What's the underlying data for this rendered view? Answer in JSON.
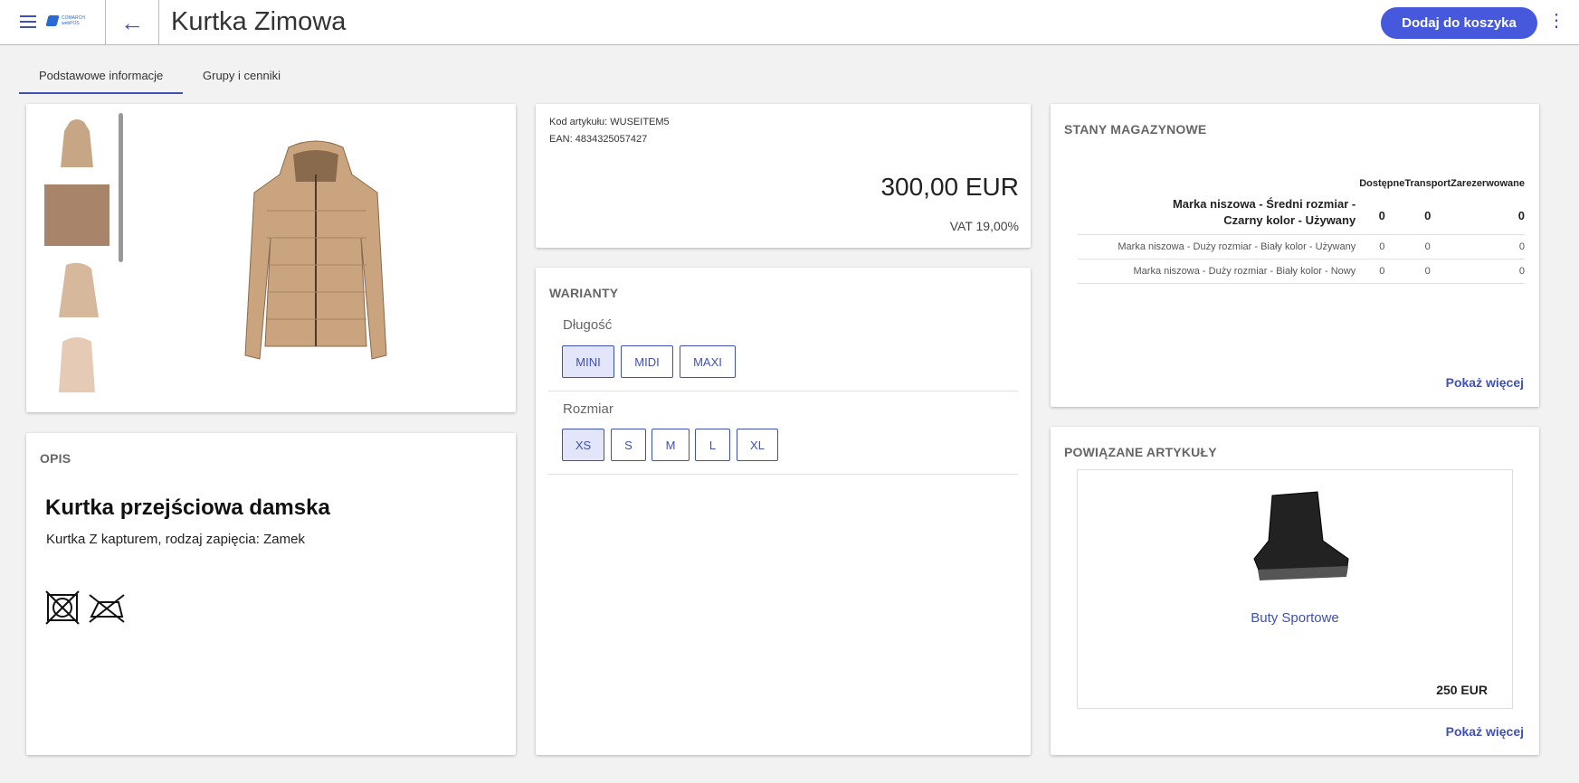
{
  "header": {
    "title": "Kurtka Zimowa",
    "add_to_cart": "Dodaj do koszyka",
    "logo_text": "COMARCH webPOS"
  },
  "tabs": [
    {
      "label": "Podstawowe informacje",
      "active": true
    },
    {
      "label": "Grupy i cenniki",
      "active": false
    }
  ],
  "article": {
    "code": "Kod artykułu: WUSEITEM5",
    "ean": "EAN: 4834325057427",
    "price": "300,00 EUR",
    "vat": "VAT 19,00%"
  },
  "description": {
    "title": "OPIS",
    "heading": "Kurtka przejściowa damska",
    "text": "Kurtka Z kapturem, rodzaj zapięcia: Zamek"
  },
  "variants": {
    "title": "WARIANTY",
    "groups": [
      {
        "label": "Długość",
        "options": [
          "MINI",
          "MIDI",
          "MAXI"
        ],
        "selected": "MINI"
      },
      {
        "label": "Rozmiar",
        "options": [
          "XS",
          "S",
          "M",
          "L",
          "XL"
        ],
        "selected": "XS"
      }
    ]
  },
  "stock": {
    "title": "STANY MAGAZYNOWE",
    "columns": [
      "Dostępne",
      "Transport",
      "Zarezerwowane"
    ],
    "rows": [
      {
        "name": "Marka niszowa - Średni rozmiar - Czarny kolor - Używany",
        "values": [
          "0",
          "0",
          "0"
        ]
      },
      {
        "name": "Marka niszowa - Duży rozmiar - Biały kolor - Używany",
        "values": [
          "0",
          "0",
          "0"
        ]
      },
      {
        "name": "Marka niszowa - Duży rozmiar - Biały kolor - Nowy",
        "values": [
          "0",
          "0",
          "0"
        ]
      }
    ],
    "more": "Pokaż więcej"
  },
  "related": {
    "title": "POWIĄZANE ARTYKUŁY",
    "item_name": "Buty Sportowe",
    "item_price": "250 EUR",
    "more": "Pokaż więcej"
  },
  "colors": {
    "accent": "#3f51b5",
    "button": "#4659dc"
  }
}
